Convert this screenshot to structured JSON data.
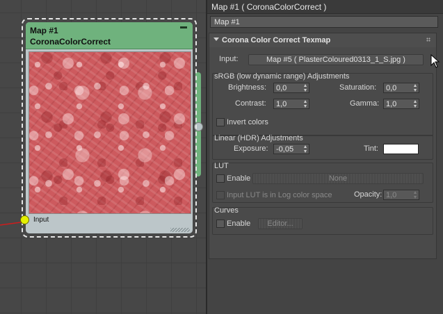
{
  "node": {
    "title": "Map #1",
    "subtitle": "CoronaColorCorrect",
    "input_label": "Input"
  },
  "panel": {
    "window_title": "Map #1  ( CoronaColorCorrect )",
    "name_field": "Map #1",
    "rollout_title": "Corona Color Correct Texmap",
    "input_label": "Input:",
    "input_button": "Map #5 ( PlasterColoured0313_1_S.jpg )",
    "srgb": {
      "title": "sRGB (low dynamic range) Adjustments",
      "brightness_label": "Brightness:",
      "brightness": "0,0",
      "saturation_label": "Saturation:",
      "saturation": "0,0",
      "contrast_label": "Contrast:",
      "contrast": "1,0",
      "gamma_label": "Gamma:",
      "gamma": "1,0",
      "invert_label": "Invert colors"
    },
    "linear": {
      "title": "Linear (HDR) Adjustments",
      "exposure_label": "Exposure:",
      "exposure": "-0,05",
      "tint_label": "Tint:",
      "tint_color": "#ffffff"
    },
    "lut": {
      "title": "LUT",
      "enable_label": "Enable",
      "file_button": "None",
      "log_label": "Input LUT is in Log color space",
      "opacity_label": "Opacity:",
      "opacity": "1,0"
    },
    "curves": {
      "title": "Curves",
      "enable_label": "Enable",
      "editor_button": "Editor..."
    }
  },
  "colors": {
    "node_header": "#6fb27d",
    "input_port": "#e4f000",
    "wire": "#d01c1c",
    "panel_bg": "#444444"
  }
}
